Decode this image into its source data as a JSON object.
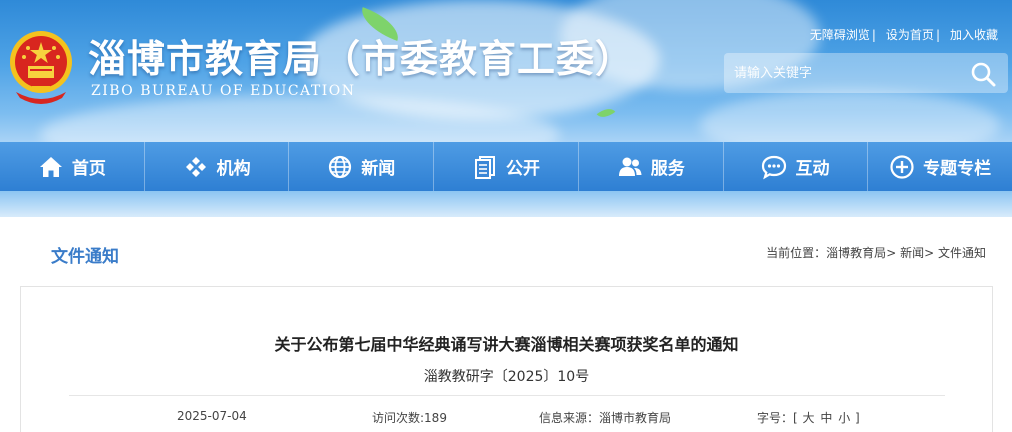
{
  "header": {
    "title": "淄博市教育局（市委教育工委）",
    "subtitle": "ZIBO BUREAU OF EDUCATION",
    "links": [
      "无障碍浏览",
      "设为首页",
      "加入收藏"
    ],
    "separator": "|",
    "emblem_icon": "national-emblem-icon"
  },
  "search": {
    "placeholder": "请输入关键字",
    "icon": "search-icon"
  },
  "nav": [
    {
      "label": "首页",
      "icon": "home-icon"
    },
    {
      "label": "机构",
      "icon": "organization-icon"
    },
    {
      "label": "新闻",
      "icon": "globe-icon"
    },
    {
      "label": "公开",
      "icon": "documents-icon"
    },
    {
      "label": "服务",
      "icon": "users-icon"
    },
    {
      "label": "互动",
      "icon": "chat-icon"
    },
    {
      "label": "专题专栏",
      "icon": "add-circle-icon"
    }
  ],
  "section": {
    "title": "文件通知"
  },
  "breadcrumb": {
    "prefix": "当前位置：",
    "items": [
      "淄博教育局",
      "新闻",
      "文件通知"
    ],
    "separator": ">"
  },
  "article": {
    "title": "关于公布第七届中华经典诵写讲大赛淄博相关赛项获奖名单的通知",
    "doc_number": "淄教教研字〔2025〕10号",
    "date": "2025-07-04",
    "visits_label": "访问次数:",
    "visits": "189",
    "source_label": "信息来源：",
    "source": "淄博市教育局",
    "font_label": "字号：",
    "font_sizes": [
      "大",
      "中",
      "小"
    ]
  },
  "colors": {
    "nav_bg": "#2e7fd3",
    "section_title": "#3a7cc9",
    "banner_top": "#2f8ad8"
  }
}
